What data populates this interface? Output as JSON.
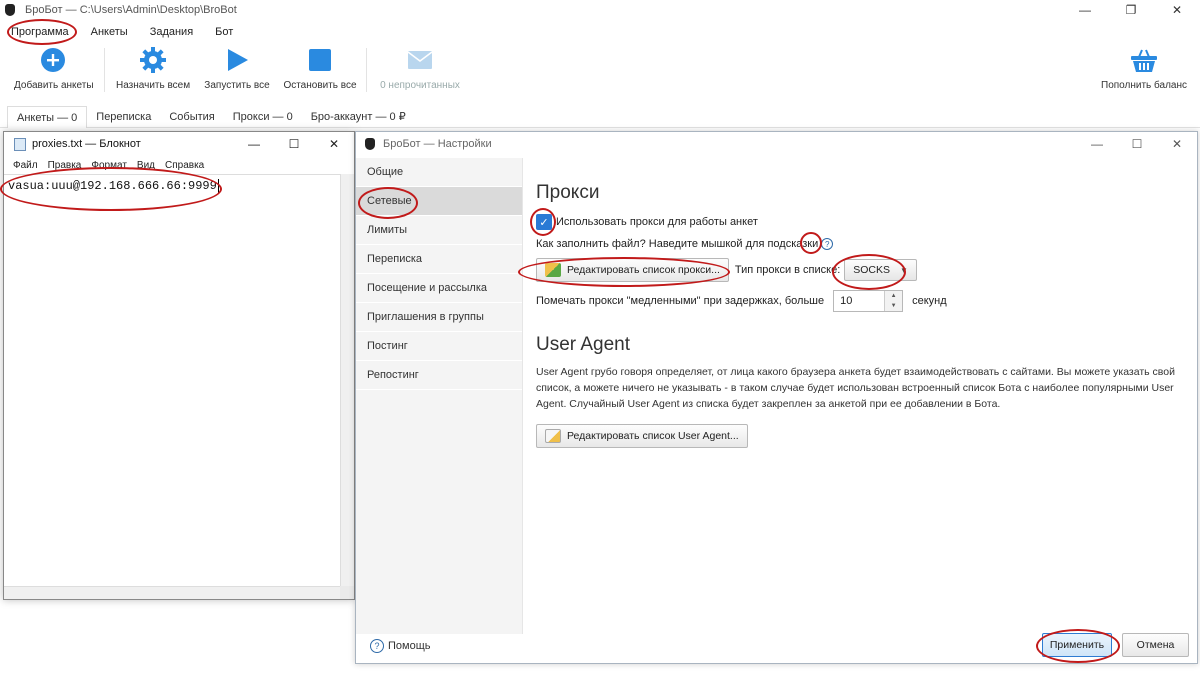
{
  "window": {
    "title": "БроБот — C:\\Users\\Admin\\Desktop\\BroBot",
    "controls": [
      "—",
      "❐",
      "✕"
    ]
  },
  "menu": [
    "Программа",
    "Анкеты",
    "Задания",
    "Бот"
  ],
  "toolbar": {
    "add": "Добавить анкеты",
    "assign": "Назначить всем",
    "start": "Запустить все",
    "stop": "Остановить все",
    "unread": "0 непрочитанных",
    "topup": "Пополнить баланс"
  },
  "tabs": [
    "Анкеты — 0",
    "Переписка",
    "События",
    "Прокси — 0",
    "Бро-аккаунт — 0 ₽"
  ],
  "notepad": {
    "title": "proxies.txt — Блокнот",
    "controls": [
      "—",
      "☐",
      "✕"
    ],
    "menu": [
      "Файл",
      "Правка",
      "Формат",
      "Вид",
      "Справка"
    ],
    "content": "vasua:uuu@192.168.666.66:9999"
  },
  "settings": {
    "title": "БроБот — Настройки",
    "controls": [
      "—",
      "☐",
      "✕"
    ],
    "nav": [
      "Общие",
      "Сетевые",
      "Лимиты",
      "Переписка",
      "Посещение и рассылка",
      "Приглашения в группы",
      "Постинг",
      "Репостинг"
    ],
    "proxy": {
      "heading": "Прокси",
      "use_proxy": "Использовать прокси для работы анкет",
      "checkmark": "✓",
      "hint": "Как заполнить файл? Наведите мышкой для подсказки",
      "hint_icon": "?",
      "edit_button": "Редактировать список прокси...",
      "type_label": "Тип прокси в списке:",
      "type_value": "SOCKS",
      "slow_label": "Помечать прокси \"медленными\" при задержках, больше",
      "slow_value": "10",
      "slow_unit": "секунд"
    },
    "ua": {
      "heading": "User Agent",
      "description": "User Agent грубо говоря определяет, от лица какого браузера анкета будет взаимодействовать с сайтами. Вы можете указать свой список, а можете ничего не указывать - в таком случае будет использован встроенный список Бота с наиболее популярными User Agent. Случайный User Agent из списка будет закреплен за анкетой при ее добавлении в Бота.",
      "edit_button": "Редактировать список User Agent..."
    },
    "footer": {
      "help": "Помощь",
      "help_icon": "?",
      "apply": "Применить",
      "cancel": "Отмена"
    }
  },
  "colors": {
    "accent": "#2a8ae0",
    "disabled": "#b9d6ee",
    "highlight": "#c11a1a"
  }
}
